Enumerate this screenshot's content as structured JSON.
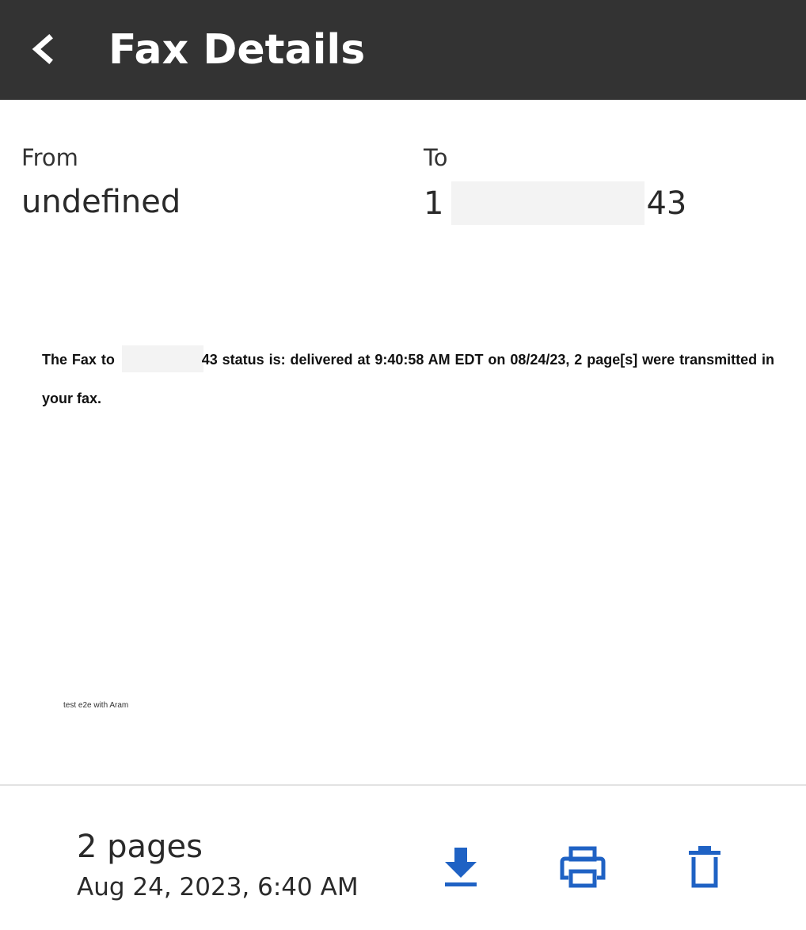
{
  "header": {
    "title": "Fax Details",
    "back_icon": "chevron-left-icon",
    "background": "#333333"
  },
  "from": {
    "label": "From",
    "value": "undefined"
  },
  "to": {
    "label": "To",
    "value_prefix": "1",
    "value_suffix": "43"
  },
  "preview": {
    "status_prefix": "The Fax to",
    "status_suffix": "43 status is: delivered at 9:40:58 AM EDT on 08/24/23, 2 page[s] were transmitted in your fax.",
    "footnote": "test e2e with Aram"
  },
  "footer": {
    "pages": "2 pages",
    "date": "Aug 24, 2023, 6:40 AM",
    "actions": [
      {
        "name": "download",
        "icon": "download-icon"
      },
      {
        "name": "print",
        "icon": "printer-icon"
      },
      {
        "name": "delete",
        "icon": "trash-icon"
      }
    ],
    "accent_color": "#1f62c4"
  }
}
